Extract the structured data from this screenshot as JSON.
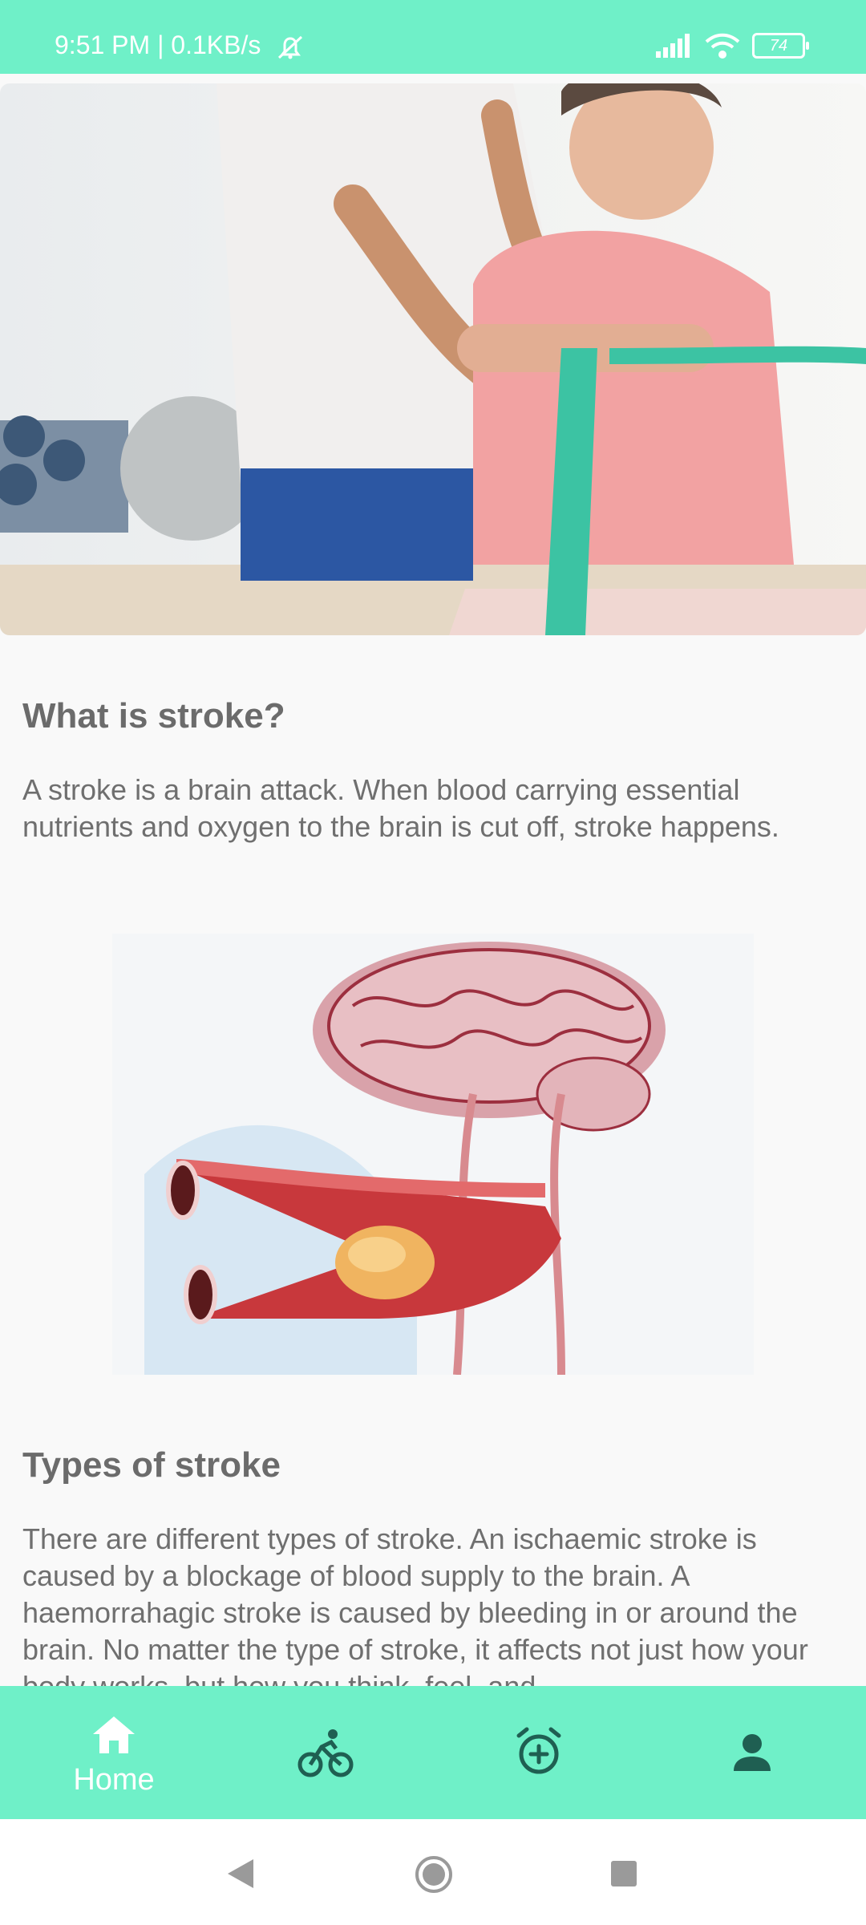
{
  "status_bar": {
    "time": "9:51 PM | 0.1KB/s",
    "battery": "74"
  },
  "carousel": {
    "dots": 5,
    "active_index": 3
  },
  "article": {
    "section1": {
      "title": "What is stroke?",
      "text": "A stroke is a brain attack. When blood carrying essential nutrients and oxygen to the brain is cut off, stroke happens."
    },
    "section2": {
      "title": "Types of stroke",
      "text": "There are different types of stroke. An ischaemic stroke is caused by a blockage of blood supply to the brain. A haemorrahagic stroke is caused by bleeding in or around the brain. No matter the type of stroke, it affects not just how your body works, but how you think, feel, and"
    }
  },
  "bottom_nav": {
    "home_label": "Home",
    "icons": [
      "home-icon",
      "cycling-icon",
      "alarm-add-icon",
      "person-icon"
    ]
  },
  "colors": {
    "accent": "#6ff0c8",
    "dark_icon": "#1f5f52"
  }
}
